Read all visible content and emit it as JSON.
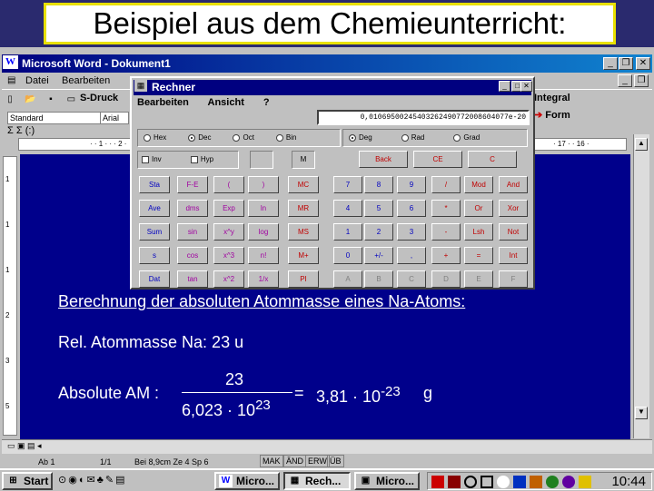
{
  "banner": {
    "title": "Beispiel aus dem Chemieunterricht:"
  },
  "word": {
    "title": "Microsoft Word - Dokument1",
    "app_icon": "W",
    "menu": [
      "Datei",
      "Bearbeiten"
    ],
    "toolbar_right": {
      "integral": "Integral",
      "form": "Form"
    },
    "style_combo": "Standard",
    "font_combo": "Arial",
    "sdruck": "S-Druck",
    "ruler_marks": "· · 1 · · · 2 ·",
    "ruler_marks_right": "· 17 · · 16 ·",
    "status": {
      "seite": "Ab 1",
      "pos": "1/1",
      "bei": "Bei 8,9cm  Ze 4  Sp 6",
      "flags": [
        "MAK",
        "ÄND",
        "ERW",
        "ÜB"
      ]
    }
  },
  "calc": {
    "title": "Rechner",
    "menu": [
      "Bearbeiten",
      "Ansicht",
      "?"
    ],
    "display": "0,01069500245403262490772008604077e-20",
    "base_radios": [
      {
        "label": "Hex",
        "on": false
      },
      {
        "label": "Dec",
        "on": true
      },
      {
        "label": "Oct",
        "on": false
      },
      {
        "label": "Bin",
        "on": false
      }
    ],
    "angle_radios": [
      {
        "label": "Deg",
        "on": true
      },
      {
        "label": "Rad",
        "on": false
      },
      {
        "label": "Grad",
        "on": false
      }
    ],
    "checks": [
      "Inv",
      "Hyp"
    ],
    "mem_key": "M",
    "edit_keys": [
      "Back",
      "CE",
      "C"
    ],
    "sci_keys": [
      [
        "Sta",
        "F-E",
        "(",
        ")"
      ],
      [
        "Ave",
        "dms",
        "Exp",
        "ln"
      ],
      [
        "Sum",
        "sin",
        "x^y",
        "log"
      ],
      [
        "s",
        "cos",
        "x^3",
        "n!"
      ],
      [
        "Dat",
        "tan",
        "x^2",
        "1/x"
      ]
    ],
    "mem_keys": [
      "MC",
      "MR",
      "MS",
      "M+",
      "PI"
    ],
    "num_keys": [
      [
        "7",
        "8",
        "9",
        "/",
        "Mod",
        "And"
      ],
      [
        "4",
        "5",
        "6",
        "*",
        "Or",
        "Xor"
      ],
      [
        "1",
        "2",
        "3",
        "-",
        "Lsh",
        "Not"
      ],
      [
        "0",
        "+/-",
        ",",
        "+",
        "=",
        "Int"
      ],
      [
        "A",
        "B",
        "C",
        "D",
        "E",
        "F"
      ]
    ]
  },
  "doc": {
    "heading": "Berechnung der absoluten Atommasse eines Na-Atoms:",
    "line1": "Rel. Atommasse Na: 23 u",
    "abs_label": "Absolute AM :",
    "numerator": "23",
    "denominator_base": "6,023 · 10",
    "denominator_exp": "23",
    "equals": "=",
    "result_base": "3,81 · 10",
    "result_exp": "-23",
    "unit": "g"
  },
  "taskbar": {
    "start": "Start",
    "buttons": [
      {
        "label": "Micro...",
        "icon": "W",
        "pressed": false
      },
      {
        "label": "Rech...",
        "icon": "▦",
        "pressed": true
      },
      {
        "label": "Micro...",
        "icon": "▣",
        "pressed": false
      }
    ],
    "clock": "10:44"
  }
}
